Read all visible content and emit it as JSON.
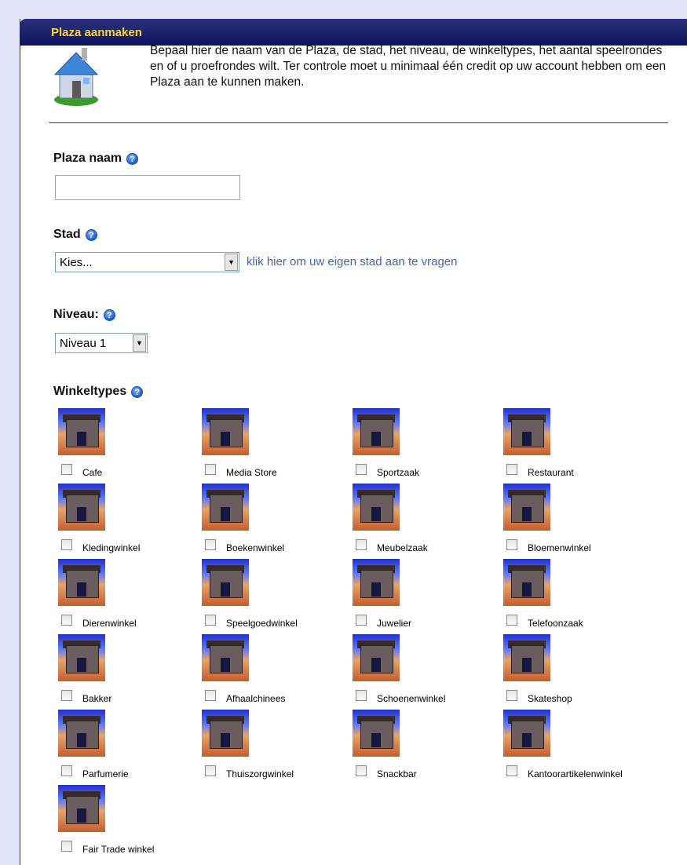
{
  "panel": {
    "title": "Plaza aanmaken",
    "intro": "Bepaal hier de naam van de Plaza, de stad, het niveau, de winkeltypes, het aantal speelrondes en of u proefrondes wilt. Ter controle moet u minimaal één credit op uw account hebben om een Plaza aan te kunnen maken."
  },
  "form": {
    "plaza_name_label": "Plaza naam",
    "plaza_name_value": "",
    "city_label": "Stad",
    "city_selected": "Kies...",
    "city_link": "klik hier om uw eigen stad aan te vragen",
    "level_label": "Niveau:",
    "level_selected": "Niveau 1",
    "shop_types_label": "Winkeltypes"
  },
  "shops": [
    {
      "label": "Cafe",
      "checked": false
    },
    {
      "label": "Media Store",
      "checked": false
    },
    {
      "label": "Sportzaak",
      "checked": false
    },
    {
      "label": "Restaurant",
      "checked": false
    },
    {
      "label": "Kledingwinkel",
      "checked": false
    },
    {
      "label": "Boekenwinkel",
      "checked": false
    },
    {
      "label": "Meubelzaak",
      "checked": false
    },
    {
      "label": "Bloemenwinkel",
      "checked": false
    },
    {
      "label": "Dierenwinkel",
      "checked": false
    },
    {
      "label": "Speelgoedwinkel",
      "checked": false
    },
    {
      "label": "Juwelier",
      "checked": false
    },
    {
      "label": "Telefoonzaak",
      "checked": false
    },
    {
      "label": "Bakker",
      "checked": false
    },
    {
      "label": "Afhaalchinees",
      "checked": false
    },
    {
      "label": "Schoenenwinkel",
      "checked": false
    },
    {
      "label": "Skateshop",
      "checked": false
    },
    {
      "label": "Parfumerie",
      "checked": false
    },
    {
      "label": "Thuiszorgwinkel",
      "checked": false
    },
    {
      "label": "Snackbar",
      "checked": false
    },
    {
      "label": "Kantoorartikelenwinkel",
      "checked": false
    },
    {
      "label": "Fair Trade winkel",
      "checked": false
    }
  ]
}
